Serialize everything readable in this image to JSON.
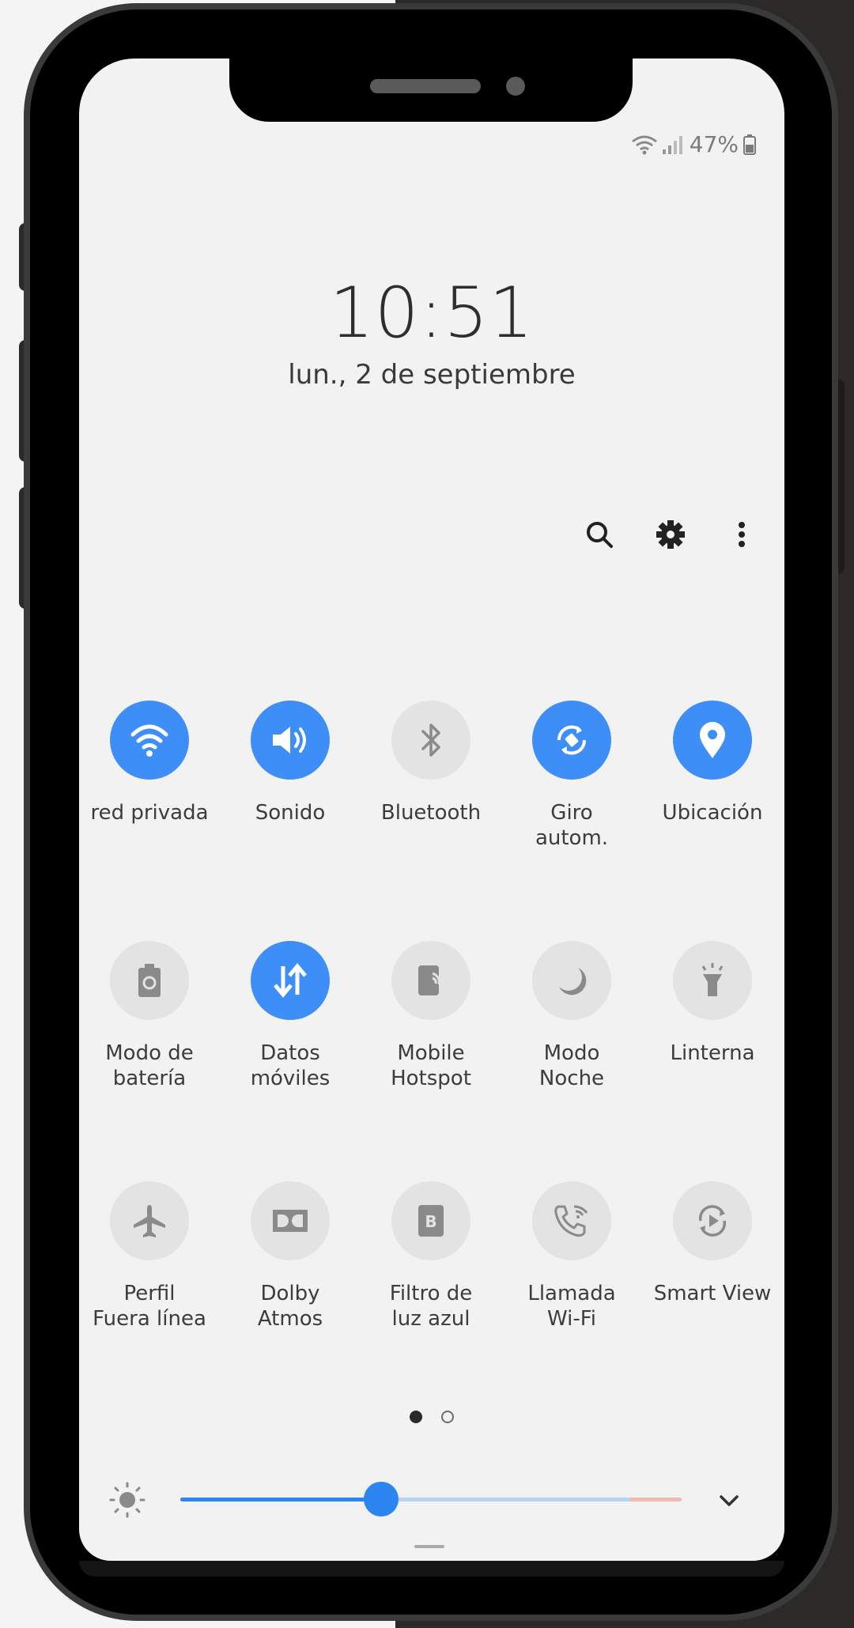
{
  "status_bar": {
    "battery": "47%"
  },
  "lockscreen": {
    "time": "10:51",
    "date": "lun., 2 de septiembre"
  },
  "toolbar": [
    "search-icon",
    "gear-icon",
    "more-vertical-icon"
  ],
  "accent_color": "#3e8ef7",
  "tiles": [
    [
      {
        "label": "red privada",
        "icon": "wifi-icon",
        "on": true
      },
      {
        "label": "Sonido",
        "icon": "speaker-icon",
        "on": true
      },
      {
        "label": "Bluetooth",
        "icon": "bluetooth-icon",
        "on": false
      },
      {
        "label": "Giro\nautom.",
        "icon": "rotate-icon",
        "on": true
      },
      {
        "label": "Ubicación",
        "icon": "location-icon",
        "on": true
      }
    ],
    [
      {
        "label": "Modo de\nbatería",
        "icon": "battery-saver-icon",
        "on": false
      },
      {
        "label": "Datos\nmóviles",
        "icon": "mobile-data-icon",
        "on": true
      },
      {
        "label": "Mobile\nHotspot",
        "icon": "hotspot-icon",
        "on": false
      },
      {
        "label": "Modo\nNoche",
        "icon": "moon-icon",
        "on": false
      },
      {
        "label": "Linterna",
        "icon": "flashlight-icon",
        "on": false
      }
    ],
    [
      {
        "label": "Perfil\nFuera línea",
        "icon": "airplane-icon",
        "on": false
      },
      {
        "label": "Dolby\nAtmos",
        "icon": "dolby-icon",
        "on": false
      },
      {
        "label": "Filtro de\nluz azul",
        "icon": "blue-light-filter-icon",
        "on": false
      },
      {
        "label": "Llamada\nWi-Fi",
        "icon": "wifi-call-icon",
        "on": false
      },
      {
        "label": "Smart View",
        "icon": "smart-view-icon",
        "on": false
      }
    ]
  ],
  "pages": {
    "count": 2,
    "active": 0
  },
  "brightness": {
    "level": 0.4
  }
}
